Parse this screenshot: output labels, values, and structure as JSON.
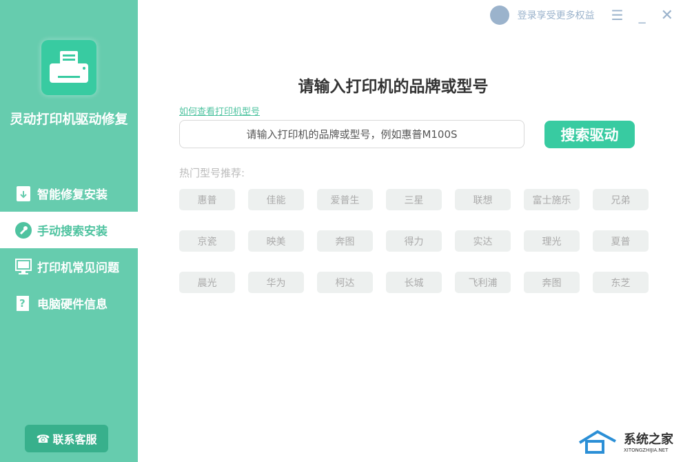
{
  "app": {
    "name": "灵动打印机驱动修复"
  },
  "sidebar": {
    "items": [
      {
        "label": "智能修复安装"
      },
      {
        "label": "手动搜索安装"
      },
      {
        "label": "打印机常见问题"
      },
      {
        "label": "电脑硬件信息"
      }
    ],
    "support": "联系客服"
  },
  "topbar": {
    "login": "登录享受更多权益"
  },
  "main": {
    "title": "请输入打印机的品牌或型号",
    "howto": "如何查看打印机型号",
    "placeholder": "请输入打印机的品牌或型号，例如惠普M100S",
    "search": "搜索驱动",
    "hot_label": "热门型号推荐:",
    "brands": [
      "惠普",
      "佳能",
      "爱普生",
      "三星",
      "联想",
      "富士施乐",
      "兄弟",
      "京瓷",
      "映美",
      "奔图",
      "得力",
      "实达",
      "理光",
      "夏普",
      "晨光",
      "华为",
      "柯达",
      "长城",
      "飞利浦",
      "奔图",
      "东芝"
    ]
  },
  "watermark": {
    "name": "系统之家",
    "url": "XITONGZHIJIA.NET"
  }
}
